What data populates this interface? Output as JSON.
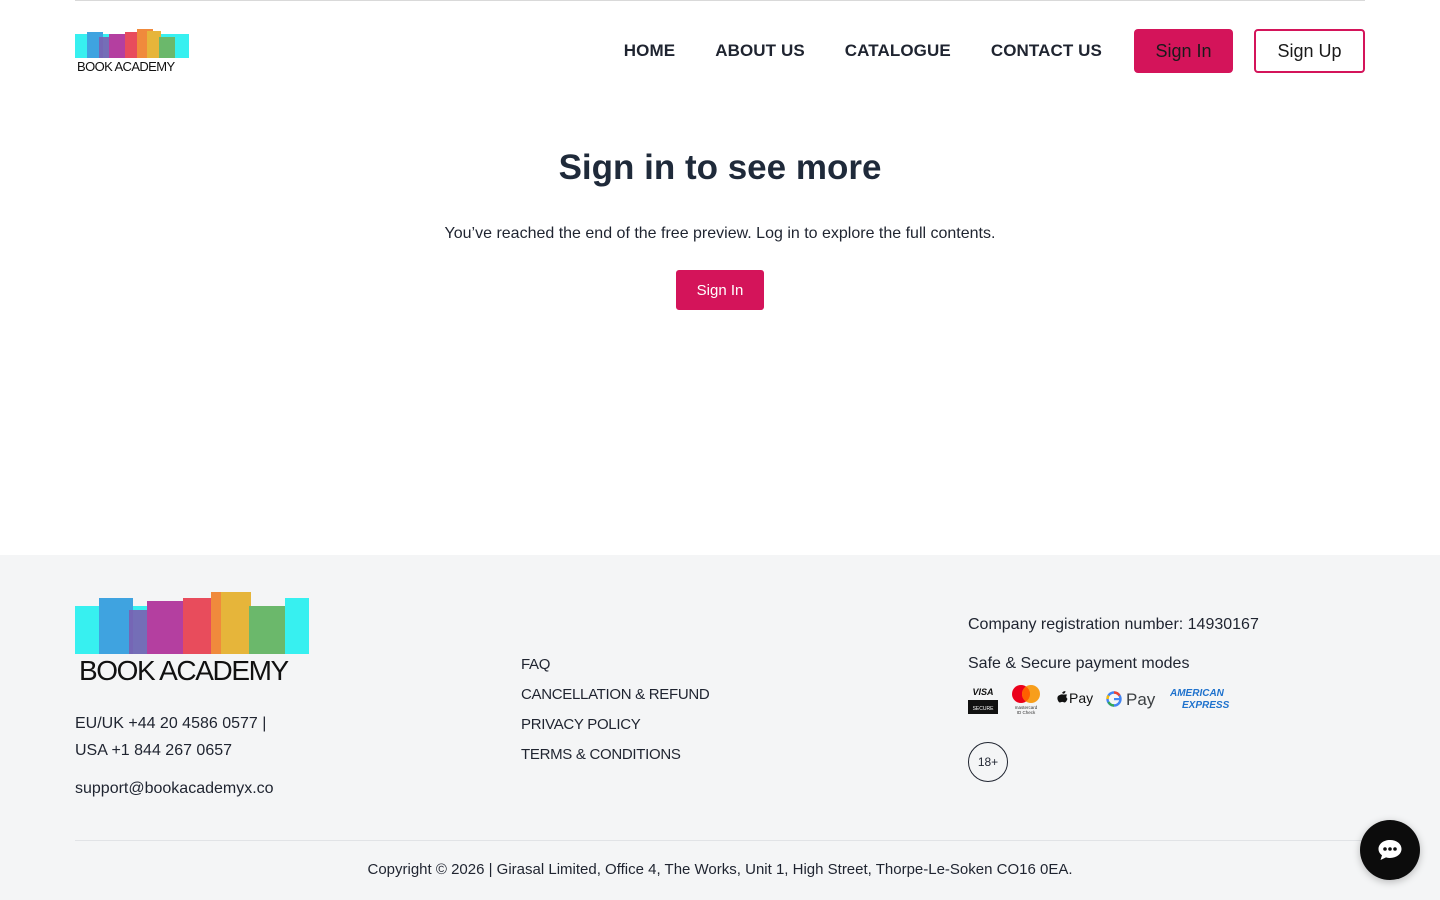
{
  "brand": {
    "name": "BOOK ACADEMY",
    "accent_color": "#d4145a",
    "book_colors": [
      "#37f0f0",
      "#3fa3e0",
      "#7b5fb0",
      "#b43fa0",
      "#e84c5c",
      "#f08a3c",
      "#e6b53a",
      "#6bb86b",
      "#37f0f0"
    ]
  },
  "nav": {
    "items": [
      {
        "label": "HOME"
      },
      {
        "label": "ABOUT US"
      },
      {
        "label": "CATALOGUE"
      },
      {
        "label": "CONTACT US"
      }
    ],
    "sign_in_label": "Sign In",
    "sign_up_label": "Sign Up"
  },
  "main": {
    "title": "Sign in to see more",
    "message": "You’ve reached the end of the free preview. Log in to explore the full contents.",
    "sign_in_label": "Sign In"
  },
  "footer": {
    "phone_eu": "EU/UK +44 20 4586 0577 |",
    "phone_us": "USA +1 844 267 0657",
    "email": "support@bookacademyx.co",
    "links": [
      {
        "label": "FAQ"
      },
      {
        "label": "CANCELLATION & REFUND"
      },
      {
        "label": "PRIVACY POLICY"
      },
      {
        "label": "TERMS & CONDITIONS"
      }
    ],
    "registration": "Company registration number: 14930167",
    "payments_heading": "Safe & Secure payment modes",
    "payment_methods": [
      "VISA SECURE",
      "mastercard ID Check",
      "Apple Pay",
      "G Pay",
      "AMERICAN EXPRESS"
    ],
    "age_badge": "18+",
    "copyright": "Copyright © 2026 | Girasal Limited, Office 4, The Works, Unit 1, High Street, Thorpe-Le-Soken CO16 0EA."
  },
  "chat": {
    "icon": "chat-bubble-icon"
  }
}
